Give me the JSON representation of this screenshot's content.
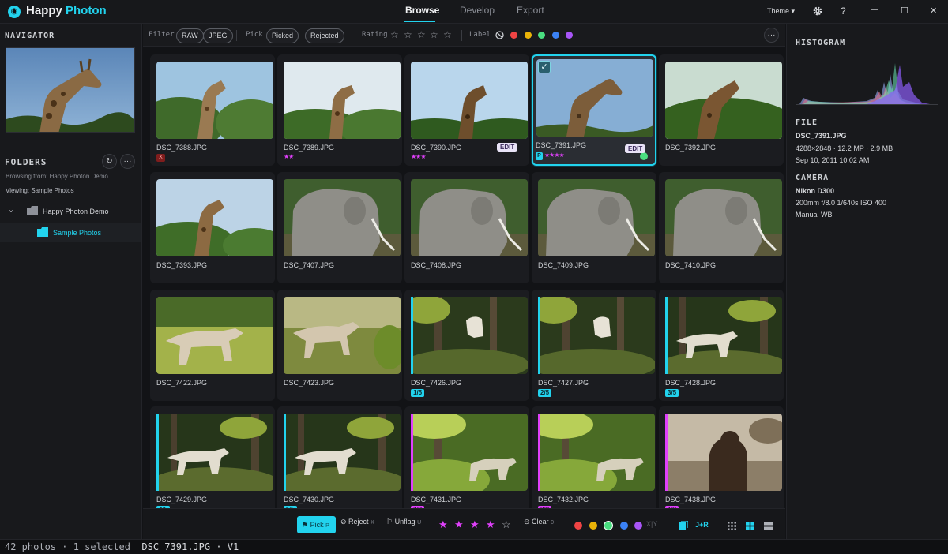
{
  "app": {
    "logo_glyph": "◉",
    "name_part1": "Happy",
    "name_part2": "Photon",
    "accent": "#22d3ee"
  },
  "tabs": [
    {
      "label": "Browse",
      "active": true
    },
    {
      "label": "Develop"
    },
    {
      "label": "Export"
    }
  ],
  "window": {
    "theme_label": "Theme ▾",
    "settings_icon": "gear-icon",
    "help": "?",
    "minimize": "—",
    "maximize": "☐",
    "close": "✕"
  },
  "navigator": {
    "title": "NAVIGATOR"
  },
  "folders": {
    "title": "FOLDERS",
    "refresh": "↻",
    "more": "···",
    "browsing": "Browsing from: Happy Photon Demo",
    "viewing": "Viewing: Sample Photos",
    "root": "Happy Photon Demo",
    "child": "Sample Photos",
    "chevron": "⌄"
  },
  "filterbar": {
    "filter_label": "Filter",
    "filter_chips": [
      "RAW",
      "JPEG"
    ],
    "pick_label": "Pick",
    "pick_chips": [
      "Picked",
      "Rejected"
    ],
    "rating_label": "Rating",
    "rating_star": "☆",
    "label_label": "Label",
    "no_label_icon": "⃠",
    "label_colors": [
      "#ef4444",
      "#eab308",
      "#4ade80",
      "#3b82f6",
      "#a855f7"
    ],
    "more": "···"
  },
  "grid": [
    {
      "name": "DSC_7388.JPG",
      "scene": "giraffe-a",
      "reject": "X"
    },
    {
      "name": "DSC_7389.JPG",
      "scene": "giraffe-b",
      "stars": "★★"
    },
    {
      "name": "DSC_7390.JPG",
      "scene": "giraffe-c",
      "stars": "★★★",
      "edit": "EDIT"
    },
    {
      "name": "DSC_7391.JPG",
      "scene": "giraffe-d",
      "stars": "★★★★",
      "edit": "EDIT",
      "selected": true,
      "pick": "P",
      "check": "✓"
    },
    {
      "name": "DSC_7392.JPG",
      "scene": "giraffe-e"
    },
    {
      "name": "DSC_7393.JPG",
      "scene": "giraffe-f"
    },
    {
      "name": "DSC_7407.JPG",
      "scene": "elephant"
    },
    {
      "name": "DSC_7408.JPG",
      "scene": "elephant"
    },
    {
      "name": "DSC_7409.JPG",
      "scene": "elephant"
    },
    {
      "name": "DSC_7410.JPG",
      "scene": "elephant"
    },
    {
      "name": "DSC_7422.JPG",
      "scene": "wolf-grass"
    },
    {
      "name": "DSC_7423.JPG",
      "scene": "wolf-light"
    },
    {
      "name": "DSC_7426.JPG",
      "scene": "forest",
      "group": "1/5",
      "group_color": "c"
    },
    {
      "name": "DSC_7427.JPG",
      "scene": "forest",
      "group": "2/5",
      "group_color": "c"
    },
    {
      "name": "DSC_7428.JPG",
      "scene": "forest-wolf",
      "group": "3/5",
      "group_color": "c"
    },
    {
      "name": "DSC_7429.JPG",
      "scene": "forest-wolf",
      "group": "4/5",
      "group_color": "c"
    },
    {
      "name": "DSC_7430.JPG",
      "scene": "forest-wolf",
      "group": "5/5",
      "group_color": "c"
    },
    {
      "name": "DSC_7431.JPG",
      "scene": "forest-bright",
      "group": "1/2",
      "group_color": "m"
    },
    {
      "name": "DSC_7432.JPG",
      "scene": "forest-bright",
      "group": "2/2",
      "group_color": "m"
    },
    {
      "name": "DSC_7438.JPG",
      "scene": "bear",
      "group": "1/2",
      "group_color": "m"
    }
  ],
  "bottombar": {
    "pick": "Pick",
    "pick_key": "P",
    "reject": "Reject",
    "reject_key": "X",
    "unflag": "Unflag",
    "unflag_key": "U",
    "rating_stars": [
      "★",
      "★",
      "★",
      "★"
    ],
    "rating_empty": "☆",
    "clear": "Clear",
    "clear_key": "0",
    "label_colors": [
      "#ef4444",
      "#eab308",
      "#4ade80",
      "#3b82f6",
      "#a855f7"
    ],
    "xy": "X|Y",
    "jr": "J+R"
  },
  "histogram": {
    "title": "HISTOGRAM"
  },
  "file": {
    "title": "FILE",
    "name": "DSC_7391.JPG",
    "specs": "4288×2848 · 12.2 MP · 2.9 MB",
    "date": "Sep 10, 2011  10:02 AM"
  },
  "camera": {
    "title": "CAMERA",
    "model": "Nikon D300",
    "settings": "200mm  f/8.0  1/640s  ISO 400",
    "wb": "Manual WB"
  },
  "status": {
    "counts": "42 photos · 1 selected",
    "file": "DSC_7391.JPG · V1"
  }
}
